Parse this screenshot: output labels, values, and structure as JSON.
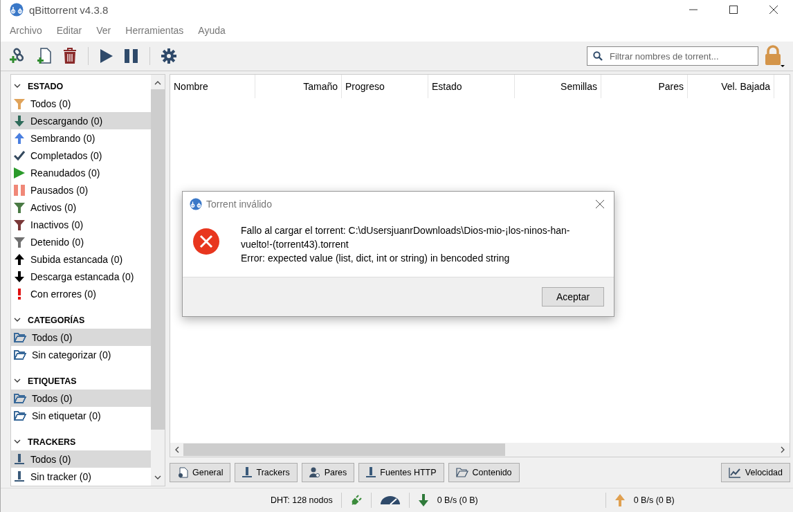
{
  "window": {
    "title": "qBittorrent v4.3.8"
  },
  "menu": [
    "Archivo",
    "Editar",
    "Ver",
    "Herramientas",
    "Ayuda"
  ],
  "toolbar": [
    {
      "kind": "add-link"
    },
    {
      "kind": "add-file"
    },
    {
      "kind": "delete"
    },
    {
      "kind": "sep"
    },
    {
      "kind": "play"
    },
    {
      "kind": "pause"
    },
    {
      "kind": "sep"
    },
    {
      "kind": "settings"
    }
  ],
  "search": {
    "placeholder": "Filtrar nombres de torrent..."
  },
  "sidebar": [
    {
      "title": "ESTADO",
      "expanded": true,
      "items": [
        {
          "label": "Todos (0)",
          "kind": "funnel",
          "color": "#e0a35a",
          "selected": false
        },
        {
          "label": "Descargando (0)",
          "kind": "down",
          "color": "#2e6b5a",
          "selected": true
        },
        {
          "label": "Sembrando (0)",
          "kind": "up",
          "color": "#4a7fe0",
          "selected": false
        },
        {
          "label": "Completados (0)",
          "kind": "check",
          "color": "#34495e",
          "selected": false
        },
        {
          "label": "Reanudados (0)",
          "kind": "play",
          "color": "#2a9a2a",
          "selected": false
        },
        {
          "label": "Pausados (0)",
          "kind": "pause",
          "color": "#f08878",
          "selected": false
        },
        {
          "label": "Activos (0)",
          "kind": "funnel",
          "color": "#4a7a44",
          "selected": false
        },
        {
          "label": "Inactivos (0)",
          "kind": "funnel",
          "color": "#7a3838",
          "selected": false
        },
        {
          "label": "Detenido (0)",
          "kind": "funnel",
          "color": "#707070",
          "selected": false
        },
        {
          "label": "Subida estancada (0)",
          "kind": "up",
          "color": "#000000",
          "selected": false
        },
        {
          "label": "Descarga estancada (0)",
          "kind": "down",
          "color": "#000000",
          "selected": false
        },
        {
          "label": "Con errores (0)",
          "kind": "error",
          "color": "#e01010",
          "selected": false
        }
      ]
    },
    {
      "title": "CATEGORÍAS",
      "expanded": true,
      "items": [
        {
          "label": "Todos (0)",
          "kind": "folder",
          "color": "#3a6a9a",
          "selected": true
        },
        {
          "label": "Sin categorizar (0)",
          "kind": "folder",
          "color": "#3a6a9a",
          "selected": false
        }
      ]
    },
    {
      "title": "ETIQUETAS",
      "expanded": true,
      "items": [
        {
          "label": "Todos (0)",
          "kind": "folder",
          "color": "#3a6a9a",
          "selected": true
        },
        {
          "label": "Sin etiquetar (0)",
          "kind": "folder",
          "color": "#3a6a9a",
          "selected": false
        }
      ]
    },
    {
      "title": "TRACKERS",
      "expanded": true,
      "items": [
        {
          "label": "Todos (0)",
          "kind": "tracker",
          "color": "#3a5a7a",
          "selected": true
        },
        {
          "label": "Sin tracker (0)",
          "kind": "tracker",
          "color": "#3a5a7a",
          "selected": false
        }
      ]
    }
  ],
  "table": {
    "columns": [
      "Nombre",
      "Tamaño",
      "Progreso",
      "Estado",
      "Semillas",
      "Pares",
      "Vel. Bajada"
    ]
  },
  "bottom_tabs": [
    {
      "label": "General",
      "kind": "doc-gear"
    },
    {
      "label": "Trackers",
      "kind": "tracker"
    },
    {
      "label": "Pares",
      "kind": "person"
    },
    {
      "label": "Fuentes HTTP",
      "kind": "tracker"
    },
    {
      "label": "Contenido",
      "kind": "folder"
    }
  ],
  "speed_button": {
    "label": "Velocidad"
  },
  "status_bar": {
    "dht": "DHT: 128 nodos",
    "download": "0 B/s (0 B)",
    "upload": "0 B/s (0 B)"
  },
  "dialog": {
    "title": "Torrent inválido",
    "message": "Fallo al cargar el torrent: C:\\dUsersjuanrDownloads\\Dios-mio-¡los-ninos-han-vuelto!-(torrent43).torrent",
    "detail": "Error: expected value (list, dict, int or string) in bencoded string",
    "button": "Aceptar"
  }
}
